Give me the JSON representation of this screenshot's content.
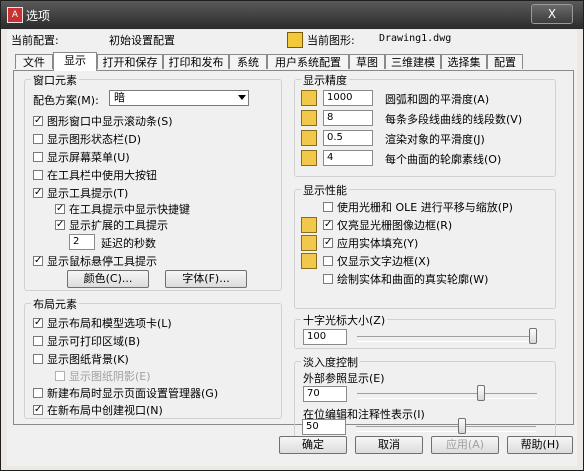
{
  "window": {
    "title": "选项",
    "close": "X"
  },
  "profile": {
    "current_profile_label": "当前配置:",
    "current_profile_value": "初始设置配置",
    "current_drawing_label": "当前图形:",
    "current_drawing_value": "Drawing1.dwg"
  },
  "tabs": [
    "文件",
    "显示",
    "打开和保存",
    "打印和发布",
    "系统",
    "用户系统配置",
    "草图",
    "三维建模",
    "选择集",
    "配置"
  ],
  "active_tab": "显示",
  "window_elements": {
    "title": "窗口元素",
    "color_scheme_label": "配色方案(M):",
    "color_scheme_value": "暗",
    "checks": [
      {
        "label": "图形窗口中显示滚动条(S)",
        "checked": true
      },
      {
        "label": "显示图形状态栏(D)",
        "checked": false
      },
      {
        "label": "显示屏幕菜单(U)",
        "checked": false
      },
      {
        "label": "在工具栏中使用大按钮",
        "checked": false
      },
      {
        "label": "显示工具提示(T)",
        "checked": true
      },
      {
        "label": "在工具提示中显示快捷键",
        "checked": true
      },
      {
        "label": "显示扩展的工具提示",
        "checked": true
      }
    ],
    "delay_value": "2",
    "delay_label": "延迟的秒数",
    "rollover_label": "显示鼠标悬停工具提示",
    "rollover_checked": true,
    "colors_button": "颜色(C)...",
    "fonts_button": "字体(F)..."
  },
  "layout_elements": {
    "title": "布局元素",
    "checks": [
      {
        "label": "显示布局和模型选项卡(L)",
        "checked": true
      },
      {
        "label": "显示可打印区域(B)",
        "checked": false
      },
      {
        "label": "显示图纸背景(K)",
        "checked": false
      },
      {
        "label": "显示图纸阴影(E)",
        "checked": false
      },
      {
        "label": "新建布局时显示页面设置管理器(G)",
        "checked": false
      },
      {
        "label": "在新布局中创建视口(N)",
        "checked": true
      }
    ]
  },
  "display_resolution": {
    "title": "显示精度",
    "rows": [
      {
        "value": "1000",
        "label": "圆弧和圆的平滑度(A)"
      },
      {
        "value": "8",
        "label": "每条多段线曲线的线段数(V)"
      },
      {
        "value": "0.5",
        "label": "渲染对象的平滑度(J)"
      },
      {
        "value": "4",
        "label": "每个曲面的轮廓素线(O)"
      }
    ]
  },
  "display_performance": {
    "title": "显示性能",
    "checks": [
      {
        "label": "使用光栅和 OLE 进行平移与缩放(P)",
        "checked": false
      },
      {
        "label": "仅亮显光栅图像边框(R)",
        "checked": true
      },
      {
        "label": "应用实体填充(Y)",
        "checked": true
      },
      {
        "label": "仅显示文字边框(X)",
        "checked": false
      },
      {
        "label": "绘制实体和曲面的真实轮廓(W)",
        "checked": false
      }
    ]
  },
  "crosshair": {
    "title": "十字光标大小(Z)",
    "value": "100",
    "level": 100
  },
  "fade": {
    "title": "淡入度控制",
    "xref_label": "外部参照显示(E)",
    "xref_value": "70",
    "xref_level": 70,
    "inplace_label": "在位编辑和注释性表示(I)",
    "inplace_value": "50",
    "inplace_level": 50
  },
  "footer": {
    "ok": "确定",
    "cancel": "取消",
    "apply": "应用(A)",
    "help": "帮助(H)"
  }
}
